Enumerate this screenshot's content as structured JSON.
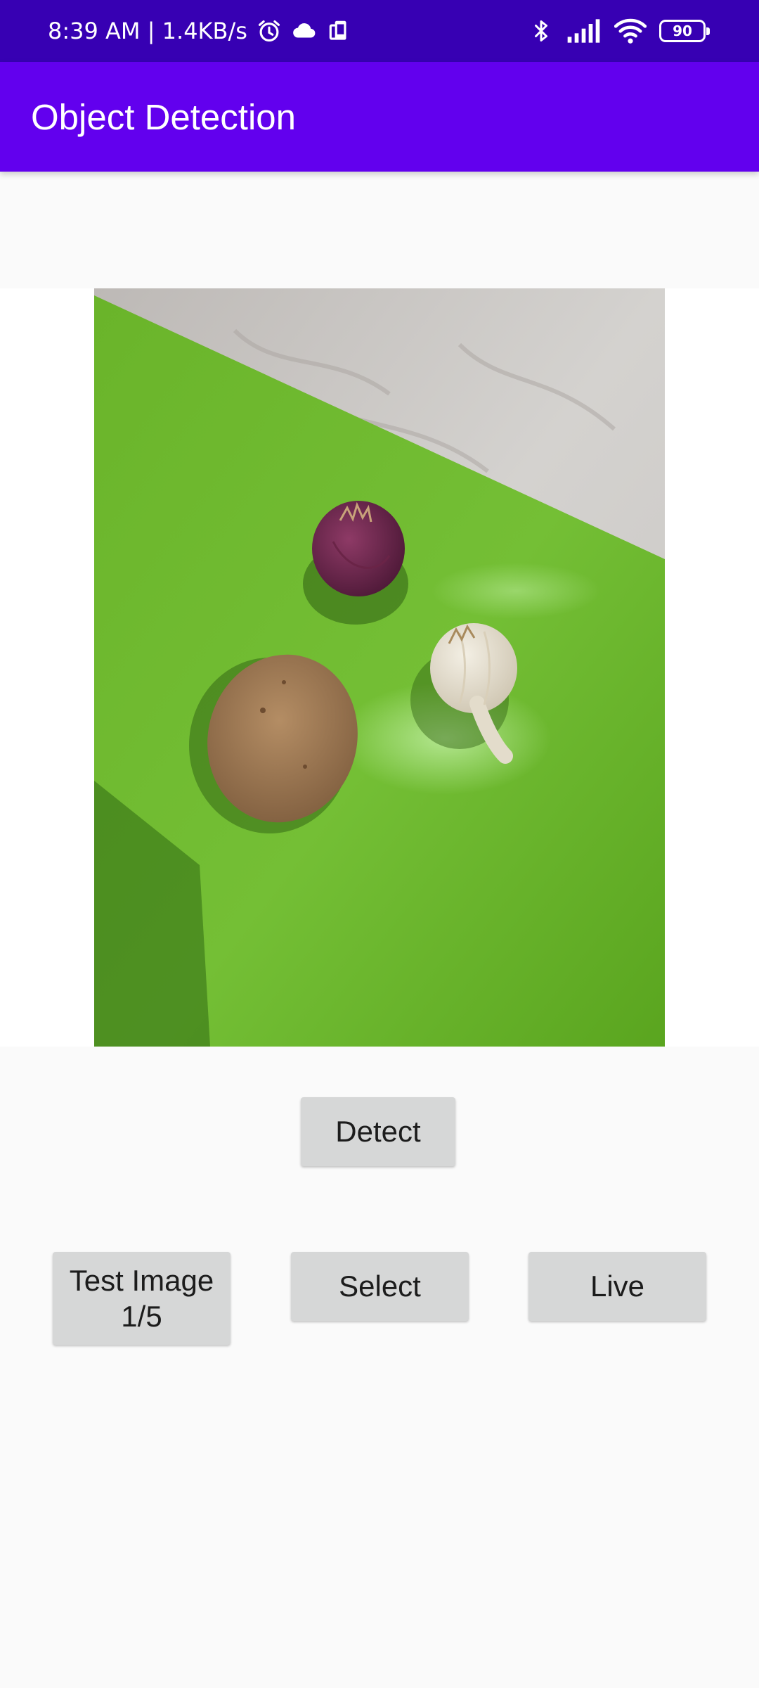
{
  "status_bar": {
    "time_net": "8:39 AM | 1.4KB/s",
    "icons": [
      "alarm-icon",
      "cloud-icon",
      "device-sync-icon",
      "bluetooth-icon",
      "signal-icon",
      "wifi-icon",
      "battery-icon"
    ],
    "battery_level": "90"
  },
  "app_bar": {
    "title": "Object Detection"
  },
  "image": {
    "subject": "photo"
  },
  "buttons": {
    "detect": "Detect",
    "test_image": "Test Image 1/5",
    "select": "Select",
    "live": "Live"
  },
  "colors": {
    "status_bar": "#3700b3",
    "app_bar": "#6200ee",
    "button_bg": "#d6d7d7",
    "background": "#fafafa"
  }
}
